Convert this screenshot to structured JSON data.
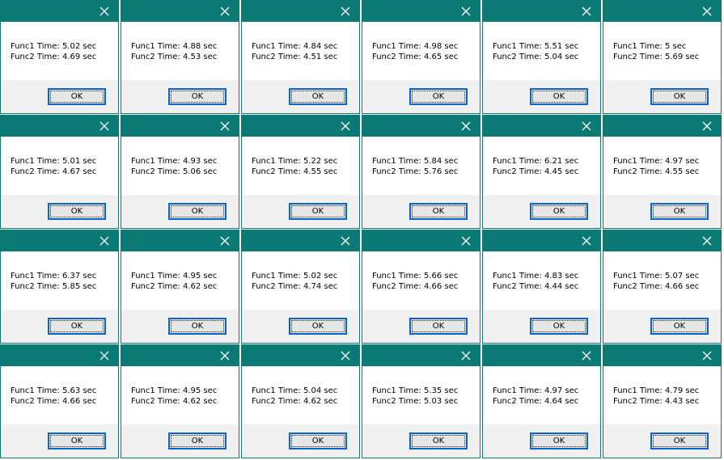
{
  "colors": {
    "titlebar": "#0b7a75",
    "close_icon": "#ffffff",
    "footer": "#f0f0f0",
    "ok_border": "#0a64c8"
  },
  "icons": {
    "close": "close-icon"
  },
  "dialogs": [
    {
      "func1": "Func1 Time: 5.02 sec",
      "func2": "Func2 Time: 4.69 sec",
      "ok": "OK"
    },
    {
      "func1": "Func1 Time: 4.88 sec",
      "func2": "Func2 Time: 4.53 sec",
      "ok": "OK"
    },
    {
      "func1": "Func1 Time: 4.84 sec",
      "func2": "Func2 Time: 4.51 sec",
      "ok": "OK"
    },
    {
      "func1": "Func1 Time: 4.98 sec",
      "func2": "Func2 Time: 4.65 sec",
      "ok": "OK"
    },
    {
      "func1": "Func1 Time: 5.51 sec",
      "func2": "Func2 Time: 5.04 sec",
      "ok": "OK"
    },
    {
      "func1": "Func1 Time: 5 sec",
      "func2": "Func2 Time: 5.69 sec",
      "ok": "OK"
    },
    {
      "func1": "Func1 Time: 5.01 sec",
      "func2": "Func2 Time: 4.67 sec",
      "ok": "OK"
    },
    {
      "func1": "Func1 Time: 4.93 sec",
      "func2": "Func2 Time: 5.06 sec",
      "ok": "OK"
    },
    {
      "func1": "Func1 Time: 5.22 sec",
      "func2": "Func2 Time: 4.55 sec",
      "ok": "OK"
    },
    {
      "func1": "Func1 Time: 5.84 sec",
      "func2": "Func2 Time: 5.76 sec",
      "ok": "OK"
    },
    {
      "func1": "Func1 Time: 6.21 sec",
      "func2": "Func2 Time: 4.45 sec",
      "ok": "OK"
    },
    {
      "func1": "Func1 Time: 4.97 sec",
      "func2": "Func2 Time: 4.55 sec",
      "ok": "OK"
    },
    {
      "func1": "Func1 Time: 6.37 sec",
      "func2": "Func2 Time: 5.85 sec",
      "ok": "OK"
    },
    {
      "func1": "Func1 Time: 4.95 sec",
      "func2": "Func2 Time: 4.62 sec",
      "ok": "OK"
    },
    {
      "func1": "Func1 Time: 5.02 sec",
      "func2": "Func2 Time: 4.74 sec",
      "ok": "OK"
    },
    {
      "func1": "Func1 Time: 5.66 sec",
      "func2": "Func2 Time: 4.66 sec",
      "ok": "OK"
    },
    {
      "func1": "Func1 Time: 4.83 sec",
      "func2": "Func2 Time: 4.44 sec",
      "ok": "OK"
    },
    {
      "func1": "Func1 Time: 5.07 sec",
      "func2": "Func2 Time: 4.66 sec",
      "ok": "OK"
    },
    {
      "func1": "Func1 Time: 5.63 sec",
      "func2": "Func2 Time: 4.66 sec",
      "ok": "OK"
    },
    {
      "func1": "Func1 Time: 4.95 sec",
      "func2": "Func2 Time: 4.62 sec",
      "ok": "OK"
    },
    {
      "func1": "Func1 Time: 5.04 sec",
      "func2": "Func2 Time: 4.62 sec",
      "ok": "OK"
    },
    {
      "func1": "Func1 Time: 5.35 sec",
      "func2": "Func2 Time: 5.03 sec",
      "ok": "OK"
    },
    {
      "func1": "Func1 Time: 4.97 sec",
      "func2": "Func2 Time: 4.64 sec",
      "ok": "OK"
    },
    {
      "func1": "Func1 Time: 4.79 sec",
      "func2": "Func2 Time: 4.43 sec",
      "ok": "OK"
    }
  ]
}
